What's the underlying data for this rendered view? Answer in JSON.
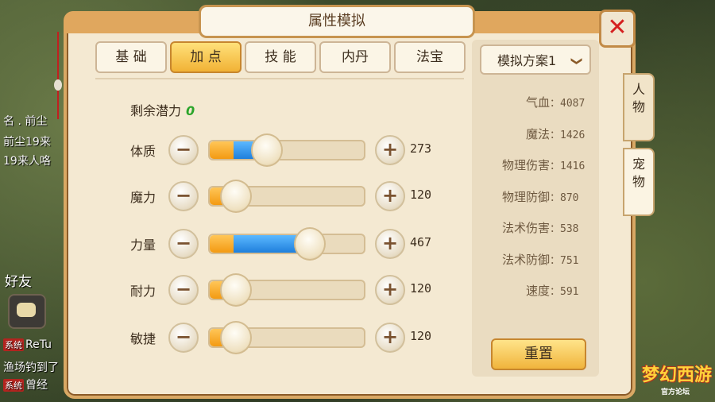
{
  "window": {
    "title": "属性模拟",
    "close": "✕"
  },
  "tabs": [
    {
      "label": "基 础",
      "active": false
    },
    {
      "label": "加 点",
      "active": true
    },
    {
      "label": "技 能",
      "active": false
    },
    {
      "label": "内丹",
      "active": false
    },
    {
      "label": "法宝",
      "active": false
    }
  ],
  "remaining_points": {
    "label": "剩余潜力",
    "value": "0"
  },
  "attributes": [
    {
      "label": "体质",
      "value": "273",
      "fill_fraction": 0.36
    },
    {
      "label": "魔力",
      "value": "120",
      "fill_fraction": 0.16
    },
    {
      "label": "力量",
      "value": "467",
      "fill_fraction": 0.64
    },
    {
      "label": "耐力",
      "value": "120",
      "fill_fraction": 0.16
    },
    {
      "label": "敏捷",
      "value": "120",
      "fill_fraction": 0.16
    }
  ],
  "buttons": {
    "minus": "−",
    "plus": "+"
  },
  "plan": {
    "label": "模拟方案1",
    "chevron": "❯"
  },
  "stats": [
    {
      "label": "气血",
      "value": "：4087"
    },
    {
      "label": "魔法",
      "value": "：1426"
    },
    {
      "label": "物理伤害",
      "value": "：1416"
    },
    {
      "label": "物理防御",
      "value": "：870"
    },
    {
      "label": "法术伤害",
      "value": "：538"
    },
    {
      "label": "法术防御",
      "value": "：751"
    },
    {
      "label": "速度",
      "value": "：591"
    }
  ],
  "reset_label": "重置",
  "side_tabs": [
    {
      "label": "人\n物",
      "active": false
    },
    {
      "label": "宠\n物",
      "active": true
    }
  ],
  "background_chat": {
    "lines": [
      "名 . 前尘",
      "前尘19来",
      "19来人咯",
      "好友",
      "ReTu",
      "渔场钓到了",
      "曾经"
    ],
    "tags": [
      "系统",
      "系统"
    ]
  },
  "logo": {
    "title": "梦幻西游",
    "subtitle": "官方论坛"
  },
  "colors": {
    "accent_orange": "#f39a12",
    "accent_blue": "#1f7fdc",
    "panel_bg": "#f4e9d2"
  }
}
